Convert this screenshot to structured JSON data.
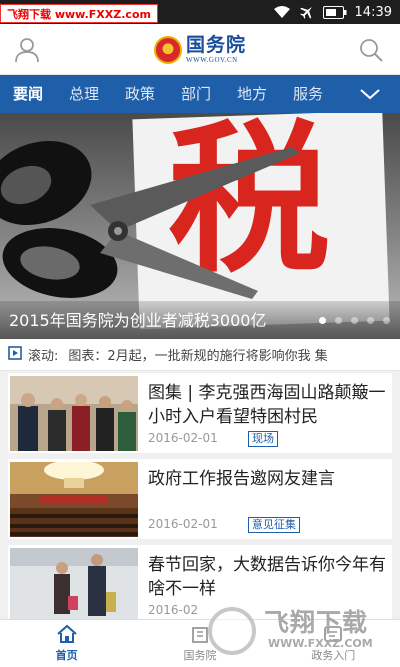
{
  "status_bar": {
    "watermark_text": "飞翔下载 www.FXXZ.com",
    "time": "14:39",
    "icons": [
      "wifi-icon",
      "airplane-icon",
      "battery-icon"
    ]
  },
  "header": {
    "logo_name": "国务院",
    "logo_url": "WWW.GOV.CN",
    "icons": [
      "user-icon",
      "search-icon"
    ]
  },
  "nav": {
    "tabs": [
      {
        "label": "要闻",
        "active": true
      },
      {
        "label": "总理",
        "active": false
      },
      {
        "label": "政策",
        "active": false
      },
      {
        "label": "部门",
        "active": false
      },
      {
        "label": "地方",
        "active": false
      },
      {
        "label": "服务",
        "active": false
      }
    ],
    "more_icon": "chevron-down-icon"
  },
  "banner": {
    "glyph": "税",
    "caption": "2015年国务院为创业者减税3000亿",
    "dot_count": 5,
    "active_dot": 0
  },
  "ticker": {
    "label": "滚动:",
    "text": "图表：2月起，一批新规的施行将影响你我  集"
  },
  "news": [
    {
      "title": "图集 | 李克强西海固山路颠簸一小时入户看望特困村民",
      "date": "2016-02-01",
      "tag": "现场"
    },
    {
      "title": "政府工作报告邀网友建言",
      "date": "2016-02-01",
      "tag": "意见征集"
    },
    {
      "title": "春节回家，大数据告诉你今年有啥不一样",
      "date": "2016-02",
      "tag": ""
    }
  ],
  "bottom_tabs": [
    {
      "label": "首页",
      "icon": "home-icon",
      "active": true
    },
    {
      "label": "国务院",
      "icon": "building-icon",
      "active": false
    },
    {
      "label": "政务入门",
      "icon": "guide-icon",
      "active": false
    }
  ],
  "watermark_bottom": {
    "name": "飞翔下载",
    "url": "WWW.FXXZ.COM"
  },
  "colors": {
    "brand_blue": "#1f5ea8",
    "banner_red": "#d8261f",
    "status_bar": "#1e1e1e"
  }
}
